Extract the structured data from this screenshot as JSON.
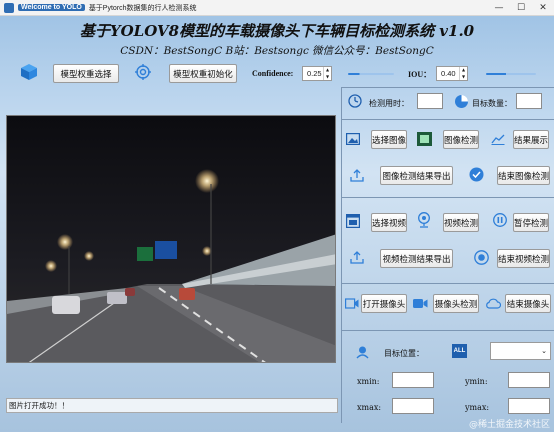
{
  "window": {
    "title": "基于Pytorch数据集的行人检测系统",
    "title_badge": "Welcome to YOLO",
    "minimize": "—",
    "maximize": "☐",
    "close": "✕"
  },
  "header": {
    "title": "基于YOLOV8模型的车载摄像头下车辆目标检测系统 v1.0",
    "subtitle": "CSDN：BestSongC    B站：Bestsongc    微信公众号：BestSongC"
  },
  "toolbar": {
    "select_weights": "模型权重选择",
    "init_weights": "模型权重初始化",
    "confidence_label": "Confidence:",
    "confidence_value": "0.25",
    "confidence_level": 0.25,
    "iou_label": "IOU：",
    "iou_value": "0.40",
    "iou_level": 0.4
  },
  "stats": {
    "time_label": "检测用时：",
    "time_value": "",
    "count_label": "目标数量：",
    "count_value": ""
  },
  "image_controls": {
    "select_image": "选择图像",
    "detect_image": "图像检测",
    "show_results": "结果展示",
    "export_image": "图像检测结果导出",
    "stop_image": "结束图像检测"
  },
  "video_controls": {
    "select_video": "选择视频",
    "detect_video": "视频检测",
    "pause": "暂停检测",
    "export_video": "视频检测结果导出",
    "stop_video": "结束视频检测"
  },
  "camera_controls": {
    "open_camera": "打开摄像头",
    "detect_camera": "摄像头检测",
    "stop_camera": "结束摄像头"
  },
  "target": {
    "position_label": "目标位置：",
    "all_icon_text": "ALL",
    "selected": "",
    "xmin_label": "xmin:",
    "ymin_label": "ymin:",
    "xmax_label": "xmax:",
    "ymax_label": "ymax:",
    "xmin": "",
    "ymin": "",
    "xmax": "",
    "ymax": ""
  },
  "status": {
    "message": "图片打开成功！！"
  },
  "watermark": "@稀土掘金技术社区",
  "colors": {
    "accent": "#2f7fd8",
    "dark_accent": "#1f5fae"
  }
}
